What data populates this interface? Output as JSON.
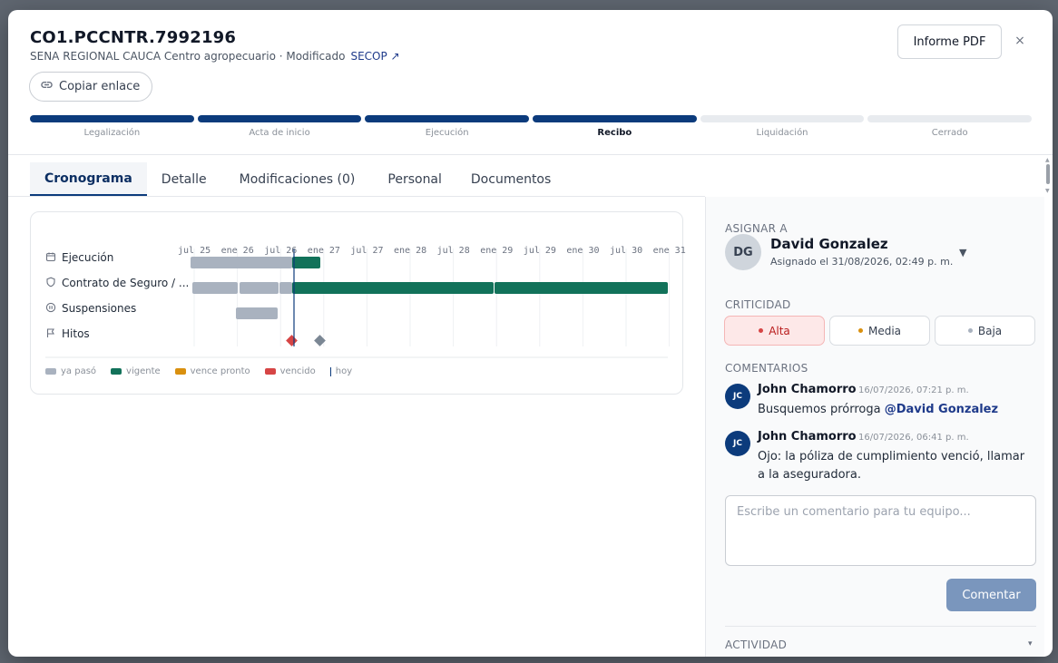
{
  "header": {
    "title": "CO1.PCCNTR.7992196",
    "subtitle": "SENA REGIONAL CAUCA Centro agropecuario · Modificado",
    "secop_link": "SECOP ↗",
    "copy_button": "Copiar enlace",
    "pdf_button": "Informe PDF",
    "close_icon": "×"
  },
  "stepper": [
    {
      "label": "Legalización",
      "state": "done"
    },
    {
      "label": "Acta de inicio",
      "state": "done"
    },
    {
      "label": "Ejecución",
      "state": "done"
    },
    {
      "label": "Recibo",
      "state": "current"
    },
    {
      "label": "Liquidación",
      "state": "pending"
    },
    {
      "label": "Cerrado",
      "state": "pending"
    }
  ],
  "tabs": [
    "Cronograma",
    "Detalle",
    "Modificaciones (0)",
    "Personal",
    "Documentos"
  ],
  "gantt": {
    "rows": [
      {
        "label": "Ejecución",
        "icon": "calendar-icon"
      },
      {
        "label": "Contrato de Seguro / ...",
        "icon": "shield-icon"
      },
      {
        "label": "Suspensiones",
        "icon": "pause-icon"
      },
      {
        "label": "Hitos",
        "icon": "flag-icon"
      }
    ],
    "ticks": [
      "jul 25",
      "ene 26",
      "jul 26",
      "ene 27",
      "jul 27",
      "ene 28",
      "jul 28",
      "ene 29",
      "jul 29",
      "ene 30",
      "jul 30",
      "ene 31"
    ],
    "legend": [
      {
        "label": "ya pasó",
        "color": "#a9b2bf"
      },
      {
        "label": "vigente",
        "color": "#12725a"
      },
      {
        "label": "vence pronto",
        "color": "#d9900f"
      },
      {
        "label": "vencido",
        "color": "#d64545"
      },
      {
        "label": "hoy",
        "color": "#0c3b7c"
      }
    ]
  },
  "sidebar": {
    "assign_title": "ASIGNAR A",
    "assignee_initials": "DG",
    "assignee_name": "David Gonzalez",
    "assignee_date": "Asignado el 31/08/2026, 02:49 p. m.",
    "dropdown_icon": "▼",
    "criticality_title": "CRITICIDAD",
    "criticality": [
      {
        "label": "Alta",
        "color": "#d64545",
        "selected": true
      },
      {
        "label": "Media",
        "color": "#d9900f",
        "selected": false
      },
      {
        "label": "Baja",
        "color": "#a9b2bf",
        "selected": false
      }
    ],
    "comments_title": "COMENTARIOS",
    "comments": [
      {
        "initials": "JC",
        "author": "John Chamorro",
        "time": "16/07/2026, 07:21 p. m.",
        "text": "Busquemos prórroga",
        "mention": "@David Gonzalez"
      },
      {
        "initials": "JC",
        "author": "John Chamorro",
        "time": "16/07/2026, 06:41 p. m.",
        "text": "Ojo: la póliza de cumplimiento venció, llamar a la aseguradora.",
        "mention": ""
      }
    ],
    "comment_placeholder": "Escribe un comentario para tu equipo...",
    "comment_button": "Comentar",
    "activity_title": "ACTIVIDAD",
    "activity_icon": "▾"
  }
}
